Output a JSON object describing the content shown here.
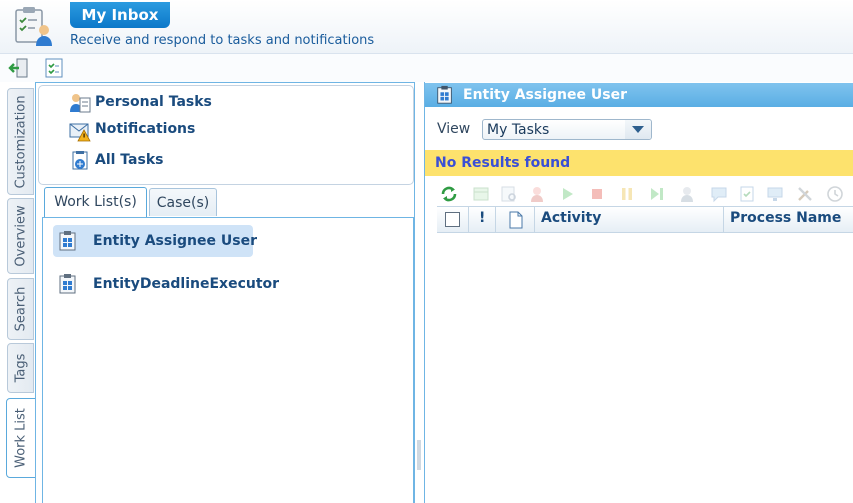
{
  "header": {
    "title": "My Inbox",
    "subtitle": "Receive and respond to tasks and notifications"
  },
  "toolbar": {
    "icons": [
      "exit-icon",
      "checklist-icon"
    ]
  },
  "side_tabs": [
    {
      "label": "Customization",
      "active": false
    },
    {
      "label": "Overview",
      "active": false
    },
    {
      "label": "Search",
      "active": false
    },
    {
      "label": "Tags",
      "active": false
    },
    {
      "label": "Work List",
      "active": true
    }
  ],
  "nav": {
    "items": [
      {
        "label": "Personal Tasks",
        "icon": "personal-tasks-icon"
      },
      {
        "label": "Notifications",
        "icon": "notification-envelope-icon"
      },
      {
        "label": "All Tasks",
        "icon": "all-tasks-icon"
      }
    ]
  },
  "left_tabs": [
    {
      "label": "Work List(s)",
      "active": true
    },
    {
      "label": "Case(s)",
      "active": false
    }
  ],
  "worklists": [
    {
      "label": "Entity Assignee User",
      "selected": true
    },
    {
      "label": "EntityDeadlineExecutor",
      "selected": false
    }
  ],
  "right_panel": {
    "title": "Entity Assignee User",
    "view_label": "View",
    "view_value": "My Tasks",
    "no_results": "No Results found",
    "columns": {
      "priority": "!",
      "activity": "Activity",
      "process_name": "Process Name"
    }
  },
  "colors": {
    "brand_blue": "#0c78c9",
    "panel_header": "#5aaee4",
    "selection": "#cfe3f7",
    "warning_bg": "#fde26d",
    "warning_text": "#3a4fd6"
  }
}
